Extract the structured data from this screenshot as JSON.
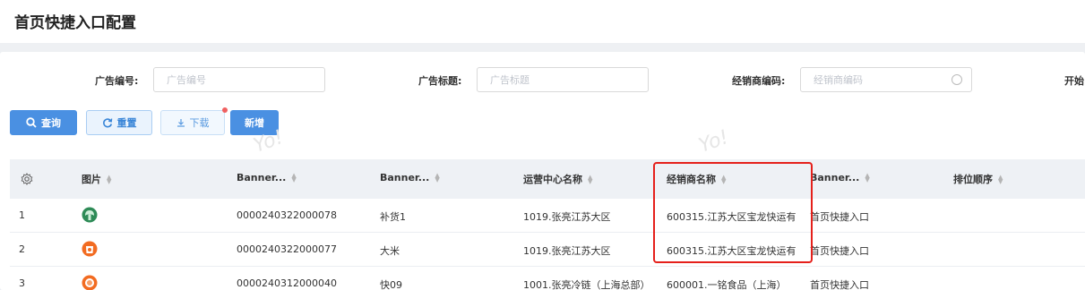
{
  "page": {
    "title": "首页快捷入口配置"
  },
  "filters": [
    {
      "label": "广告编号:",
      "placeholder": "广告编号",
      "value": ""
    },
    {
      "label": "广告标题:",
      "placeholder": "广告标题",
      "value": ""
    },
    {
      "label": "经销商编码:",
      "placeholder": "经销商编码",
      "value": ""
    },
    {
      "label": "开始",
      "placeholder": "",
      "value": ""
    }
  ],
  "buttons": {
    "query": "查询",
    "reset": "重置",
    "download": "下载",
    "add": "新增"
  },
  "watermark": "Yo!",
  "table": {
    "columns": [
      "图片",
      "Banner...",
      "Banner...",
      "运营中心名称",
      "经销商名称",
      "Banner...",
      "排位顺序"
    ],
    "rows": [
      {
        "index": "1",
        "image_icon": "cabbage-icon",
        "banner_no": "0000240322000078",
        "banner_title": "补货1",
        "center": "1019.张亮江苏大区",
        "dealer": "600315.江苏大区宝龙快运有",
        "banner_type": "首页快捷入口",
        "order": ""
      },
      {
        "index": "2",
        "image_icon": "rice-bag-icon",
        "banner_no": "0000240322000077",
        "banner_title": "大米",
        "center": "1019.张亮江苏大区",
        "dealer": "600315.江苏大区宝龙快运有",
        "banner_type": "首页快捷入口",
        "order": ""
      },
      {
        "index": "3",
        "image_icon": "astronaut-icon",
        "banner_no": "0000240312000040",
        "banner_title": "快09",
        "center": "1001.张亮冷链（上海总部）",
        "dealer": "600001.一铭食品（上海）",
        "banner_type": "首页快捷入口",
        "order": ""
      }
    ]
  },
  "colors": {
    "primary": "#4a90e2",
    "highlight": "#e5201b",
    "row_icon_green": "#2e8b57",
    "row_icon_orange": "#f26b21"
  }
}
